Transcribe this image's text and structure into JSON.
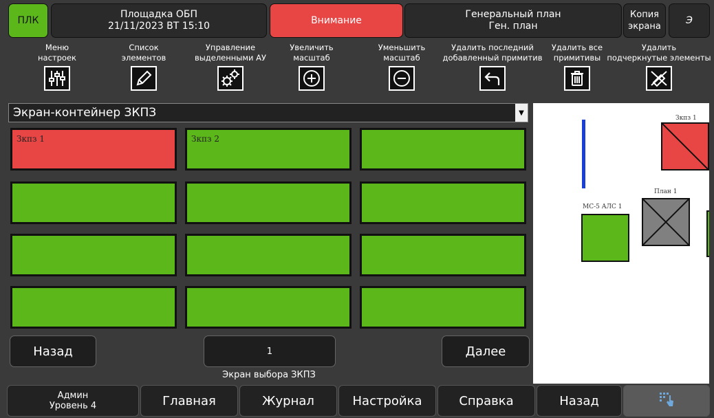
{
  "header": {
    "plc_label": "ПЛК",
    "site_title": "Площадка ОБП",
    "datetime": "21/11/2023 ВТ 15:10",
    "alarm_label": "Внимание",
    "plan_title": "Генеральный план",
    "plan_subtitle": "Ген. план",
    "copy_label_1": "Копия",
    "copy_label_2": "экрана",
    "extra_label": "Э"
  },
  "toolbar": [
    {
      "line1": "Меню",
      "line2": "настроек",
      "icon": "sliders-icon"
    },
    {
      "line1": "Список",
      "line2": "элементов",
      "icon": "pencil-icon"
    },
    {
      "line1": "Управление",
      "line2": "выделенными АУ",
      "icon": "gears-icon"
    },
    {
      "line1": "Увеличить",
      "line2": "масштаб",
      "icon": "zoom-in-icon"
    },
    {
      "line1": "Уменьшить",
      "line2": "масштаб",
      "icon": "zoom-out-icon"
    },
    {
      "line1": "Удалить последний",
      "line2": "добавленный примитив",
      "icon": "undo-icon"
    },
    {
      "line1": "Удалить все",
      "line2": "примитивы",
      "icon": "trash-icon"
    },
    {
      "line1": "Удалить",
      "line2": "подчеркнутые элементы",
      "icon": "erase-icon"
    }
  ],
  "selector": {
    "value": "Экран-контейнер ЗКПЗ"
  },
  "grid": {
    "cells": [
      {
        "label": "Зкпз 1",
        "status": "alarm"
      },
      {
        "label": "Зкпз 2",
        "status": "ok"
      },
      {
        "label": "",
        "status": "ok"
      },
      {
        "label": "",
        "status": "ok"
      },
      {
        "label": "",
        "status": "ok"
      },
      {
        "label": "",
        "status": "ok"
      },
      {
        "label": "",
        "status": "ok"
      },
      {
        "label": "",
        "status": "ok"
      },
      {
        "label": "",
        "status": "ok"
      },
      {
        "label": "",
        "status": "ok"
      },
      {
        "label": "",
        "status": "ok"
      },
      {
        "label": "",
        "status": "ok"
      }
    ]
  },
  "pager": {
    "back_label": "Назад",
    "page": "1",
    "next_label": "Далее"
  },
  "status_text": "Экран выбора ЗКПЗ",
  "preview": {
    "zkpz_label": "Зкпз 1",
    "plan_label": "План 1",
    "mc_label": "МС-5 АЛС 1"
  },
  "bottom_nav": {
    "user": "Админ",
    "level": "Уровень 4",
    "main": "Главная",
    "journal": "Журнал",
    "settings": "Настройка",
    "help": "Справка",
    "back": "Назад",
    "touch_icon": "touch-icon"
  },
  "colors": {
    "ok": "#5cb81a",
    "alarm": "#e84545",
    "plc": "#5cb81a",
    "preview_blue": "#1a3fd6",
    "plan_gray": "#808080"
  }
}
